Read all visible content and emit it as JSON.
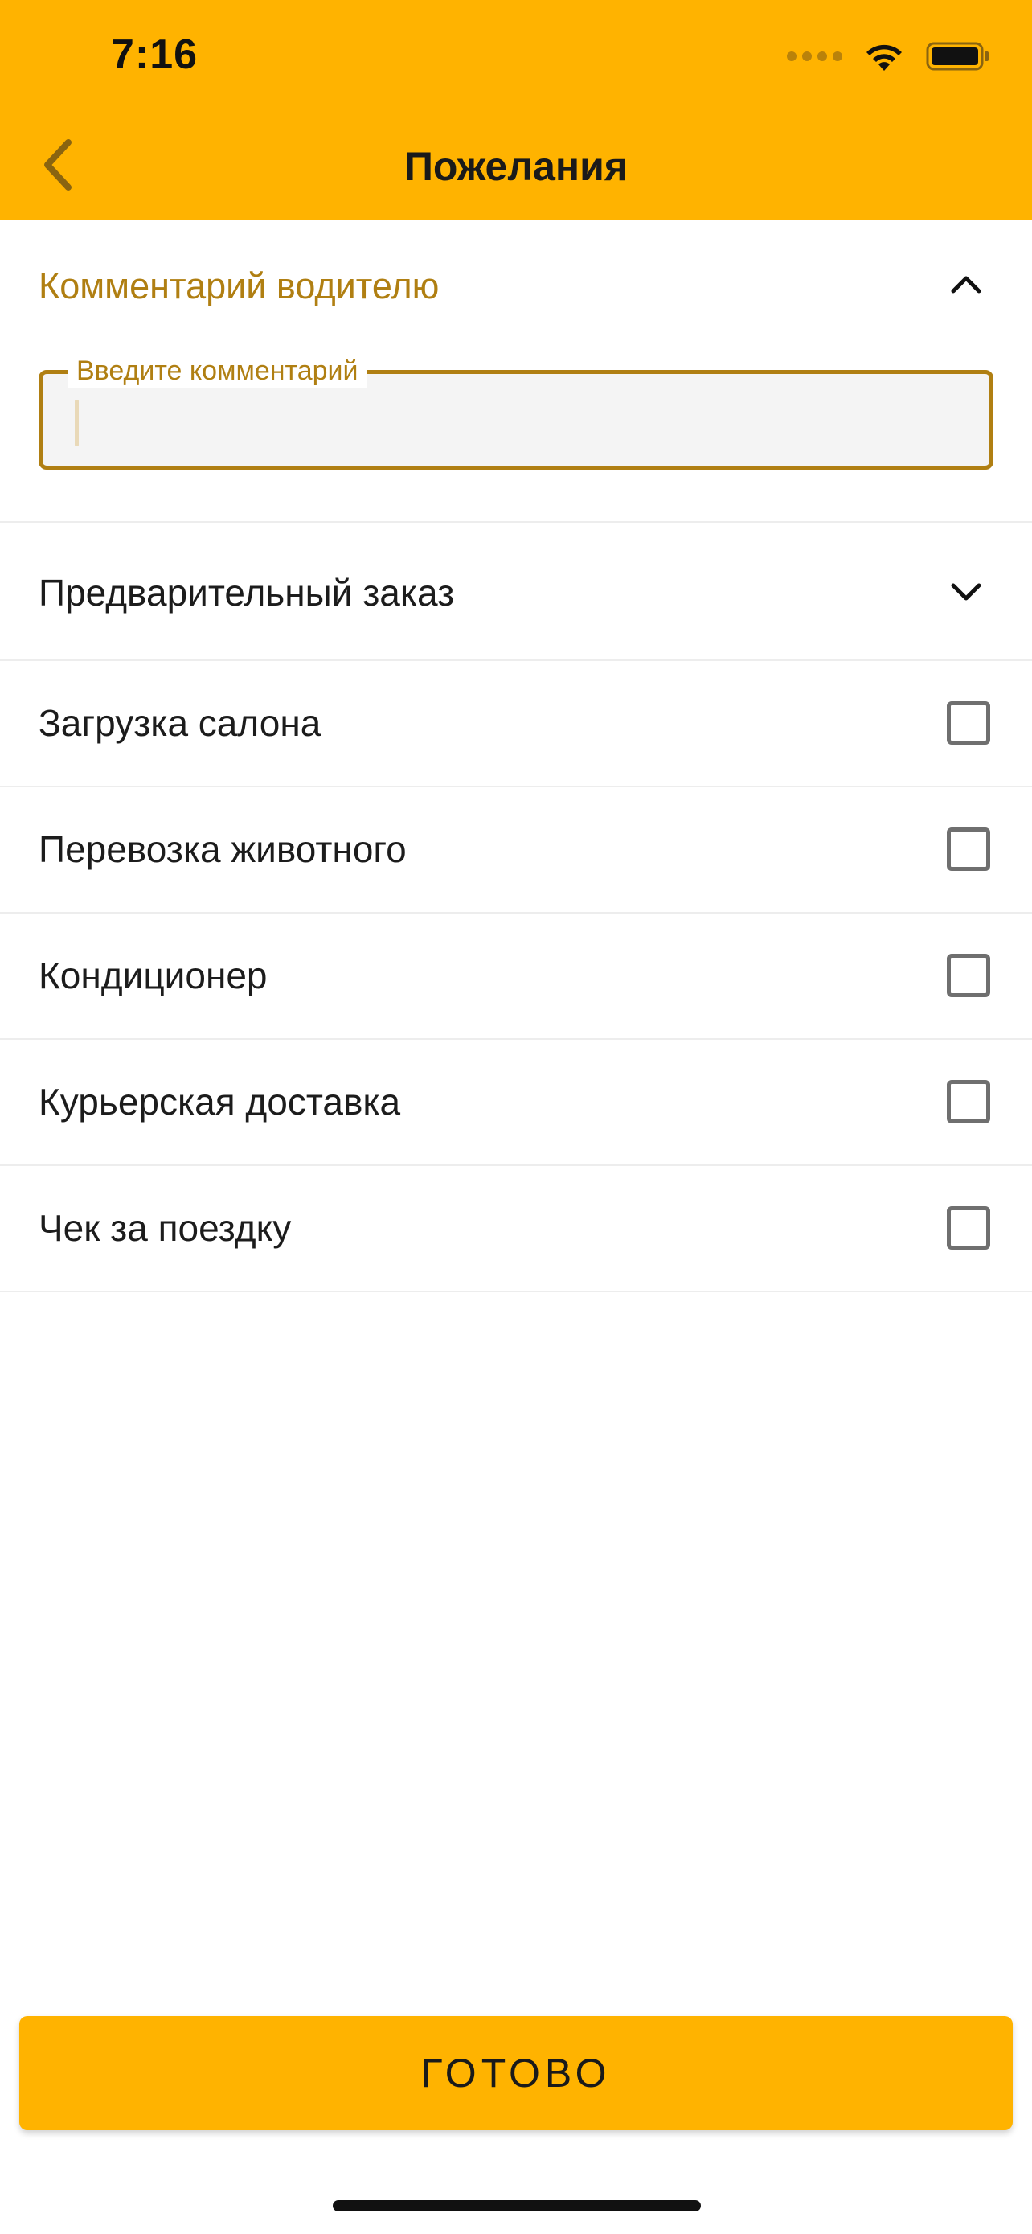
{
  "status_bar": {
    "time": "7:16"
  },
  "nav": {
    "title": "Пожелания"
  },
  "comment": {
    "section_title": "Комментарий водителю",
    "field_label": "Введите комментарий",
    "field_value": ""
  },
  "preorder": {
    "label": "Предварительный заказ"
  },
  "options": [
    {
      "label": "Загрузка салона",
      "checked": false
    },
    {
      "label": "Перевозка животного",
      "checked": false
    },
    {
      "label": "Кондиционер",
      "checked": false
    },
    {
      "label": "Курьерская доставка",
      "checked": false
    },
    {
      "label": "Чек за поездку",
      "checked": false
    }
  ],
  "footer": {
    "done_label": "ГОТОВО"
  },
  "colors": {
    "accent": "#FFB300",
    "accent_text": "#B07F12",
    "divider": "#EDEDED",
    "checkbox_border": "#6F6F6F"
  },
  "icons": {
    "back": "chevron-left-icon",
    "collapse": "chevron-up-icon",
    "expand": "chevron-down-icon"
  }
}
